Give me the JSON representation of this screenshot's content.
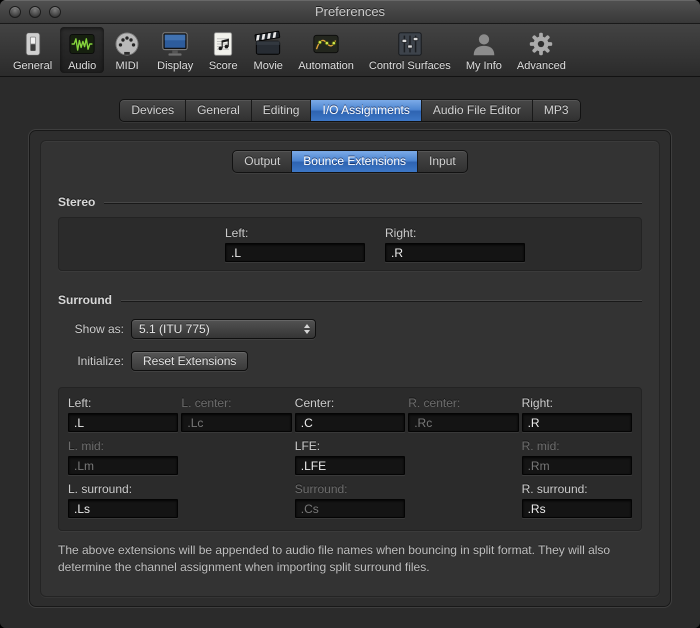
{
  "window": {
    "title": "Preferences"
  },
  "toolbar": {
    "items": [
      {
        "label": "General",
        "icon": "switch-icon",
        "selected": false
      },
      {
        "label": "Audio",
        "icon": "waveform-icon",
        "selected": true
      },
      {
        "label": "MIDI",
        "icon": "midi-din-icon",
        "selected": false
      },
      {
        "label": "Display",
        "icon": "monitor-icon",
        "selected": false
      },
      {
        "label": "Score",
        "icon": "score-sheet-icon",
        "selected": false
      },
      {
        "label": "Movie",
        "icon": "clapperboard-icon",
        "selected": false
      },
      {
        "label": "Automation",
        "icon": "automation-curve-icon",
        "selected": false
      },
      {
        "label": "Control Surfaces",
        "icon": "faders-icon",
        "selected": false
      },
      {
        "label": "My Info",
        "icon": "person-icon",
        "selected": false
      },
      {
        "label": "Advanced",
        "icon": "gear-icon",
        "selected": false
      }
    ]
  },
  "tabs": {
    "items": [
      "Devices",
      "General",
      "Editing",
      "I/O Assignments",
      "Audio File Editor",
      "MP3"
    ],
    "selected": "I/O Assignments"
  },
  "subtabs": {
    "items": [
      "Output",
      "Bounce Extensions",
      "Input"
    ],
    "selected": "Bounce Extensions"
  },
  "stereo": {
    "heading": "Stereo",
    "left_label": "Left:",
    "left_value": ".L",
    "right_label": "Right:",
    "right_value": ".R"
  },
  "surround": {
    "heading": "Surround",
    "show_as_label": "Show as:",
    "show_as_value": "5.1 (ITU 775)",
    "initialize_label": "Initialize:",
    "reset_button_label": "Reset Extensions",
    "fields": [
      {
        "label": "Left:",
        "value": ".L",
        "disabled": false
      },
      {
        "label": "L. center:",
        "value": ".Lc",
        "disabled": true
      },
      {
        "label": "Center:",
        "value": ".C",
        "disabled": false
      },
      {
        "label": "R. center:",
        "value": ".Rc",
        "disabled": true
      },
      {
        "label": "Right:",
        "value": ".R",
        "disabled": false
      },
      {
        "label": "L. mid:",
        "value": ".Lm",
        "disabled": true
      },
      {
        "label": "LFE:",
        "value": ".LFE",
        "disabled": false
      },
      {
        "label": "R. mid:",
        "value": ".Rm",
        "disabled": true
      },
      {
        "label": "L. surround:",
        "value": ".Ls",
        "disabled": false
      },
      {
        "label": "Surround:",
        "value": ".Cs",
        "disabled": true
      },
      {
        "label": "R. surround:",
        "value": ".Rs",
        "disabled": false
      }
    ],
    "footer": "The above extensions will be appended to audio file names when bouncing in split format. They will also determine the channel assignment when importing split surround files."
  }
}
